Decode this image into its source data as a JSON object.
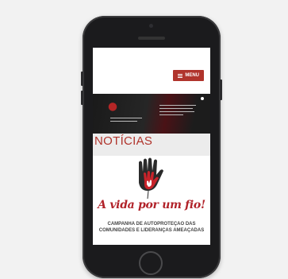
{
  "header": {
    "menu_label": "MENU"
  },
  "news": {
    "heading": "NOTÍCIAS",
    "card": {
      "slogan": "A vida por um fio!",
      "caption_line1": "CAMPANHA DE AUTOPROTEÇÃO DAS",
      "caption_line2": "COMUNIDADES E LIDERANÇAS AMEAÇADAS"
    }
  },
  "colors": {
    "accent": "#b0342c",
    "page_background": "#f2f2f2",
    "phone_body": "#1b1b1d"
  }
}
